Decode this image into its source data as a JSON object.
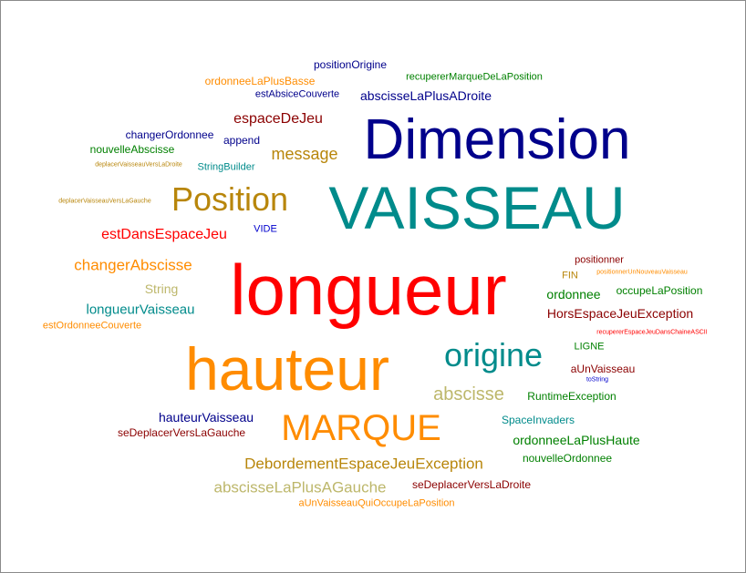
{
  "palette": {
    "navy": "#00008b",
    "teal": "#008b8b",
    "red": "#ff0000",
    "orange": "#ff8c00",
    "dark_red": "#8b0000",
    "gold": "#b8860b",
    "khaki": "#bdb76b",
    "green": "#008000",
    "blue": "#0000cd",
    "gray": "#999999"
  },
  "words": [
    {
      "text": "positionOrigine",
      "color": "#00008b"
    },
    {
      "text": "recupererMarqueDeLaPosition",
      "color": "#008000"
    },
    {
      "text": "ordonneeLaPlusBasse",
      "color": "#ff8c00"
    },
    {
      "text": "estAbsiceCouverte",
      "color": "#00008b"
    },
    {
      "text": "abscisseLaPlusADroite",
      "color": "#00008b"
    },
    {
      "text": "espaceDeJeu",
      "color": "#8b0000"
    },
    {
      "text": "Dimension",
      "color": "#00008b"
    },
    {
      "text": "changerOrdonnee",
      "color": "#00008b"
    },
    {
      "text": "append",
      "color": "#00008b"
    },
    {
      "text": "nouvelleAbscisse",
      "color": "#008000"
    },
    {
      "text": "message",
      "color": "#b8860b"
    },
    {
      "text": "deplacerVaisseauVersLaDroite",
      "color": "#b8860b"
    },
    {
      "text": "StringBuilder",
      "color": "#008b8b"
    },
    {
      "text": "VAISSEAU",
      "color": "#008b8b"
    },
    {
      "text": "Position",
      "color": "#b8860b"
    },
    {
      "text": "deplacerVaisseauVersLaGauche",
      "color": "#b8860b"
    },
    {
      "text": "estDansEspaceJeu",
      "color": "#ff0000"
    },
    {
      "text": "VIDE",
      "color": "#0000cd"
    },
    {
      "text": "positionner",
      "color": "#8b0000"
    },
    {
      "text": "changerAbscisse",
      "color": "#ff8c00"
    },
    {
      "text": "FIN",
      "color": "#b8860b"
    },
    {
      "text": "positionnerUnNouveauVaisseau",
      "color": "#ff8c00"
    },
    {
      "text": "longueur",
      "color": "#ff0000"
    },
    {
      "text": "String",
      "color": "#bdb76b"
    },
    {
      "text": "ordonnee",
      "color": "#008000"
    },
    {
      "text": "occupeLaPosition",
      "color": "#008000"
    },
    {
      "text": "longueurVaisseau",
      "color": "#008b8b"
    },
    {
      "text": "HorsEspaceJeuException",
      "color": "#8b0000"
    },
    {
      "text": "estOrdonneeCouverte",
      "color": "#ff8c00"
    },
    {
      "text": "recupererEspaceJeuDansChaineASCII",
      "color": "#ff0000"
    },
    {
      "text": "origine",
      "color": "#008b8b"
    },
    {
      "text": "LIGNE",
      "color": "#008000"
    },
    {
      "text": "hauteur",
      "color": "#ff8c00"
    },
    {
      "text": "aUnVaisseau",
      "color": "#8b0000"
    },
    {
      "text": "toString",
      "color": "#0000cd"
    },
    {
      "text": "abscisse",
      "color": "#bdb76b"
    },
    {
      "text": "RuntimeException",
      "color": "#008000"
    },
    {
      "text": "hauteurVaisseau",
      "color": "#00008b"
    },
    {
      "text": "SpaceInvaders",
      "color": "#008b8b"
    },
    {
      "text": "seDeplacerVersLaGauche",
      "color": "#8b0000"
    },
    {
      "text": "MARQUE",
      "color": "#ff8c00"
    },
    {
      "text": "ordonneeLaPlusHaute",
      "color": "#008000"
    },
    {
      "text": "nouvelleOrdonnee",
      "color": "#008000"
    },
    {
      "text": "DebordementEspaceJeuException",
      "color": "#b8860b"
    },
    {
      "text": "abscisseLaPlusAGauche",
      "color": "#bdb76b"
    },
    {
      "text": "seDeplacerVersLaDroite",
      "color": "#8b0000"
    },
    {
      "text": "aUnVaisseauQuiOccupeLaPosition",
      "color": "#ff8c00"
    }
  ]
}
